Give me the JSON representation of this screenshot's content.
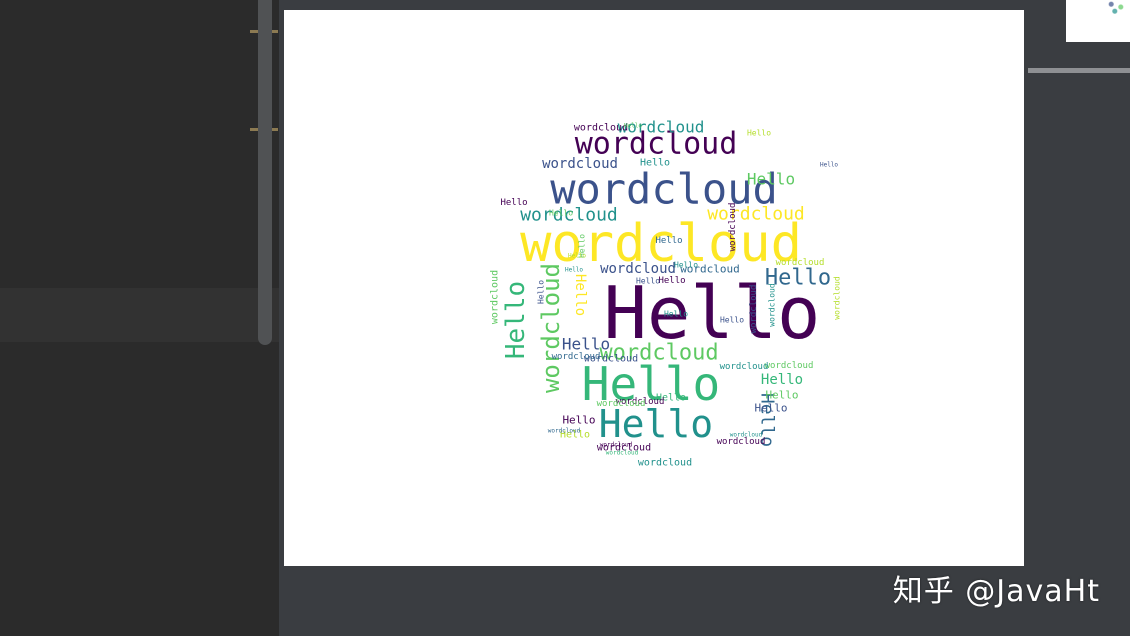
{
  "ide": {
    "watermark": "知乎 @JavaHt",
    "colors": {
      "left_panel": "#2b2b2b",
      "main_area": "#3a3d41",
      "canvas": "#ffffff",
      "gutter_mark": "#8c7a52"
    }
  },
  "figure": {
    "type": "wordcloud",
    "colormap": "viridis",
    "mask": "circle",
    "words": [
      {
        "text": "wordcloud",
        "weight": 100,
        "color": "#fde725",
        "orientation": "horizontal"
      },
      {
        "text": "Hello",
        "weight": 100,
        "color": "#440154",
        "orientation": "horizontal"
      },
      {
        "text": "wordcloud",
        "weight": 70,
        "color": "#3b528b",
        "orientation": "horizontal"
      },
      {
        "text": "Hello",
        "weight": 85,
        "color": "#35b779",
        "orientation": "horizontal"
      },
      {
        "text": "Hello",
        "weight": 70,
        "color": "#21918c",
        "orientation": "horizontal"
      },
      {
        "text": "wordcloud",
        "weight": 50,
        "color": "#440154",
        "orientation": "horizontal"
      },
      {
        "text": "wordcloud",
        "weight": 35,
        "color": "#5ec962",
        "orientation": "horizontal"
      },
      {
        "text": "Hello",
        "weight": 35,
        "color": "#31688e",
        "orientation": "horizontal"
      },
      {
        "text": "Hello",
        "weight": 35,
        "color": "#35b779",
        "orientation": "vertical"
      },
      {
        "text": "wordcloud",
        "weight": 35,
        "color": "#5ec962",
        "orientation": "vertical"
      },
      {
        "text": "wordcloud",
        "weight": 30,
        "color": "#21918c",
        "orientation": "horizontal"
      },
      {
        "text": "wordcloud",
        "weight": 30,
        "color": "#fde725",
        "orientation": "horizontal"
      },
      {
        "text": "wordcloud",
        "weight": 28,
        "color": "#3b528b",
        "orientation": "horizontal"
      },
      {
        "text": "wordcloud",
        "weight": 26,
        "color": "#21918c",
        "orientation": "horizontal"
      },
      {
        "text": "Hello",
        "weight": 28,
        "color": "#35b779",
        "orientation": "horizontal"
      },
      {
        "text": "Hello",
        "weight": 26,
        "color": "#5ec962",
        "orientation": "horizontal"
      },
      {
        "text": "Hello",
        "weight": 24,
        "color": "#3b528b",
        "orientation": "horizontal"
      },
      {
        "text": "Hello",
        "weight": 24,
        "color": "#31688e",
        "orientation": "vertical"
      },
      {
        "text": "wordcloud",
        "weight": 22,
        "color": "#3b528b",
        "orientation": "horizontal"
      },
      {
        "text": "wordcloud",
        "weight": 22,
        "color": "#31688e",
        "orientation": "horizontal"
      },
      {
        "text": "Hello",
        "weight": 20,
        "color": "#fde725",
        "orientation": "vertical"
      },
      {
        "text": "wordcloud",
        "weight": 18,
        "color": "#440154",
        "orientation": "horizontal"
      },
      {
        "text": "wordcloud",
        "weight": 18,
        "color": "#5ec962",
        "orientation": "vertical"
      },
      {
        "text": "Hello",
        "weight": 18,
        "color": "#440154",
        "orientation": "horizontal"
      },
      {
        "text": "Hello",
        "weight": 18,
        "color": "#5ec962",
        "orientation": "horizontal"
      },
      {
        "text": "Hello",
        "weight": 16,
        "color": "#b5de2b",
        "orientation": "horizontal"
      },
      {
        "text": "Hello",
        "weight": 16,
        "color": "#3b528b",
        "orientation": "horizontal"
      },
      {
        "text": "Hello",
        "weight": 16,
        "color": "#35b779",
        "orientation": "horizontal"
      },
      {
        "text": "wordcloud",
        "weight": 14,
        "color": "#440154",
        "orientation": "horizontal"
      },
      {
        "text": "wordcloud",
        "weight": 14,
        "color": "#21918c",
        "orientation": "horizontal"
      },
      {
        "text": "wordcloud",
        "weight": 12,
        "color": "#3b528b",
        "orientation": "horizontal"
      },
      {
        "text": "wordcloud",
        "weight": 12,
        "color": "#440154",
        "orientation": "horizontal"
      },
      {
        "text": "wordcloud",
        "weight": 12,
        "color": "#5ec962",
        "orientation": "horizontal"
      },
      {
        "text": "Hello",
        "weight": 12,
        "color": "#21918c",
        "orientation": "horizontal"
      },
      {
        "text": "Hello",
        "weight": 12,
        "color": "#440154",
        "orientation": "horizontal"
      },
      {
        "text": "Hello",
        "weight": 12,
        "color": "#31688e",
        "orientation": "horizontal"
      },
      {
        "text": "wordcloud",
        "weight": 12,
        "color": "#440154",
        "orientation": "vertical"
      },
      {
        "text": "wordcloud",
        "weight": 12,
        "color": "#3b528b",
        "orientation": "vertical"
      },
      {
        "text": "Hello",
        "weight": 10,
        "color": "#440154",
        "orientation": "horizontal"
      },
      {
        "text": "Hello",
        "weight": 10,
        "color": "#21918c",
        "orientation": "horizontal"
      },
      {
        "text": "Hello",
        "weight": 10,
        "color": "#3b528b",
        "orientation": "horizontal"
      },
      {
        "text": "Hello",
        "weight": 10,
        "color": "#5ec962",
        "orientation": "horizontal"
      },
      {
        "text": "wordcloud",
        "weight": 9,
        "color": "#440154",
        "orientation": "horizontal"
      },
      {
        "text": "wordcloud",
        "weight": 9,
        "color": "#21918c",
        "orientation": "horizontal"
      },
      {
        "text": "wordcloud",
        "weight": 9,
        "color": "#5ec962",
        "orientation": "horizontal"
      },
      {
        "text": "wordcloud",
        "weight": 9,
        "color": "#31688e",
        "orientation": "horizontal"
      },
      {
        "text": "wordcloud",
        "weight": 9,
        "color": "#b5de2b",
        "orientation": "horizontal"
      },
      {
        "text": "Hello",
        "weight": 8,
        "color": "#3b528b",
        "orientation": "horizontal"
      },
      {
        "text": "Hello",
        "weight": 8,
        "color": "#21918c",
        "orientation": "horizontal"
      },
      {
        "text": "Hello",
        "weight": 8,
        "color": "#b5de2b",
        "orientation": "horizontal"
      },
      {
        "text": "Hello",
        "weight": 8,
        "color": "#5ec962",
        "orientation": "vertical"
      },
      {
        "text": "Hello",
        "weight": 8,
        "color": "#3b528b",
        "orientation": "vertical"
      },
      {
        "text": "wordcloud",
        "weight": 8,
        "color": "#21918c",
        "orientation": "vertical"
      },
      {
        "text": "wordcloud",
        "weight": 8,
        "color": "#b5de2b",
        "orientation": "vertical"
      },
      {
        "text": "Hello",
        "weight": 6,
        "color": "#b5de2b",
        "orientation": "horizontal"
      },
      {
        "text": "Hello",
        "weight": 6,
        "color": "#21918c",
        "orientation": "horizontal"
      },
      {
        "text": "Hello",
        "weight": 6,
        "color": "#5ec962",
        "orientation": "horizontal"
      },
      {
        "text": "Hello",
        "weight": 6,
        "color": "#3b528b",
        "orientation": "horizontal"
      },
      {
        "text": "wordcloud",
        "weight": 6,
        "color": "#440154",
        "orientation": "horizontal"
      },
      {
        "text": "wordcloud",
        "weight": 6,
        "color": "#35b779",
        "orientation": "horizontal"
      },
      {
        "text": "wordcloud",
        "weight": 6,
        "color": "#31688e",
        "orientation": "horizontal"
      },
      {
        "text": "wordcloud",
        "weight": 6,
        "color": "#21918c",
        "orientation": "horizontal"
      }
    ]
  }
}
